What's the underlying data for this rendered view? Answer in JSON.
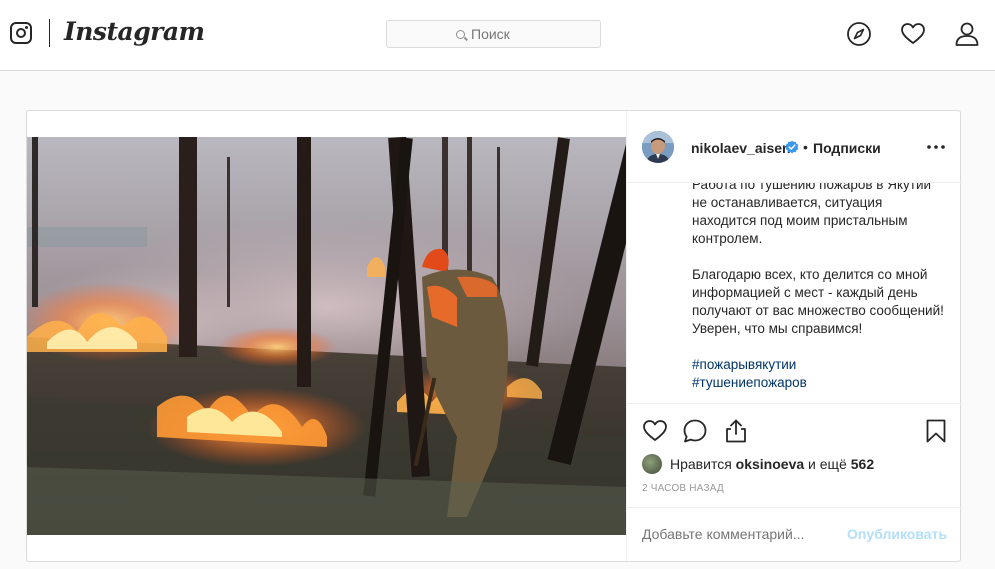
{
  "header": {
    "logo_text": "Instagram",
    "search_placeholder": "Поиск",
    "icons": [
      "instagram-glyph-icon",
      "search-icon",
      "compass-icon",
      "heart-icon",
      "profile-icon"
    ]
  },
  "post": {
    "username": "nikolaev_aisen",
    "verified": true,
    "separator": "•",
    "follow_label": "Подписки",
    "caption": {
      "paragraph1": "Работа по тушению пожаров в Якутии не останавливается, ситуация находится под моим пристальным контролем.",
      "paragraph2": "Благодарю всех, кто делится со мной информацией с мест - каждый день получают от вас множество сообщений! Уверен, что мы справимся!",
      "hashtags": [
        "#пожарывякутии",
        "#тушениепожаров"
      ]
    },
    "likes": {
      "prefix": "Нравится",
      "user": "oksinoeva",
      "middle": "и ещё",
      "count": "562"
    },
    "time": "2 часов назад",
    "comment_placeholder": "Добавьте комментарий...",
    "publish_label": "Опубликовать",
    "colors": {
      "verified": "#3897f0",
      "hashtag": "#003569",
      "publish_disabled": "#b2dffc"
    }
  }
}
